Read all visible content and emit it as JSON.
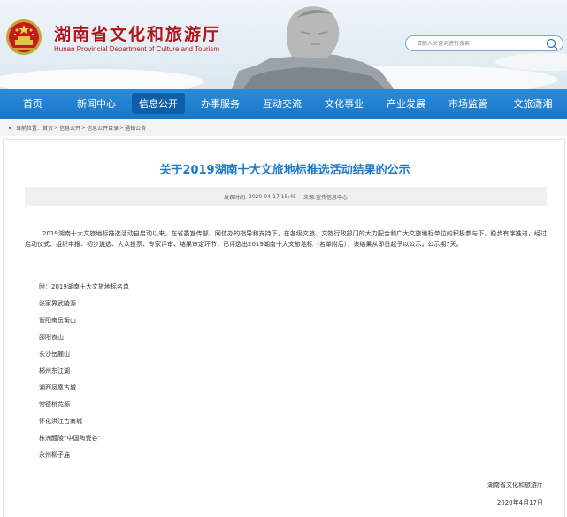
{
  "header": {
    "title": "湖南省文化和旅游厅",
    "subtitle": "Hunan Provincial Department of Culture and Tourism",
    "search_placeholder": "请输入关键词进行搜索"
  },
  "nav": {
    "items": [
      "首页",
      "新闻中心",
      "信息公开",
      "办事服务",
      "互动交流",
      "文化事业",
      "产业发展",
      "市场监管",
      "文旅潇湘"
    ],
    "active_index": 2
  },
  "breadcrumb": {
    "prefix": "当前位置：",
    "items": [
      "首页",
      "信息公开",
      "信息公开目录",
      "通知公告"
    ],
    "separator": ">"
  },
  "article": {
    "title": "关于2019湖南十大文旅地标推选活动结果的公示",
    "meta_time_label": "发表时间:",
    "meta_time": "2020-04-17 15:45",
    "meta_source_label": "来源:",
    "meta_source": "宣传信息中心",
    "paragraph": "2019湖南十大文旅地标推选活动自启动以来，在省委宣传部、网信办的指导和支持下，在各级文旅、文物行政部门的大力配合和广大文旅地标单位的积极参与下，稳步有序推进，经过启动仪式、组织申报、初步遴选、大众投票、专家评审、结果审定环节，已评选出2019湖南十大文旅地标（名单附后），该结果从即日起予以公示，公示期7天。",
    "list_title": "附：2019湖南十大文旅地标名单",
    "list": [
      "张家界武陵源",
      "衡阳南岳衡山",
      "邵阳崀山",
      "长沙岳麓山",
      "郴州东江湖",
      "湘西凤凰古城",
      "常德桃花源",
      "怀化洪江古商城",
      "株洲醴陵“中国陶瓷谷”",
      "永州柳子庙"
    ],
    "sign_org": "湖南省文化和旅游厅",
    "sign_date": "2020年4月17日"
  },
  "colors": {
    "brand_red": "#b3141a",
    "nav_blue": "#1a76c7",
    "title_blue": "#1d78c8"
  }
}
